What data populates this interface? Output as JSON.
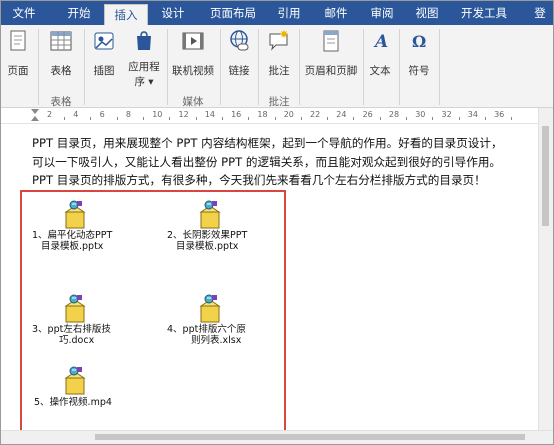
{
  "tabs": [
    "文件",
    "开始",
    "插入",
    "设计",
    "页面布局",
    "引用",
    "邮件",
    "审阅",
    "视图",
    "开发工具",
    "登"
  ],
  "ribbon": {
    "buttons": {
      "page": "页面",
      "table": "表格",
      "illustrations": "插图",
      "apps": "应用程",
      "apps2": "序 ▾",
      "online_video": "联机视频",
      "links": "链接",
      "comment": "批注",
      "header_footer": "页眉和页脚",
      "text": "文本",
      "symbols": "符号"
    },
    "groups": {
      "table": "表格",
      "media": "媒体",
      "comments": "批注"
    }
  },
  "ruler": {
    "numbers": [
      "2",
      "4",
      "6",
      "8",
      "10",
      "12",
      "14",
      "16",
      "18",
      "20",
      "22",
      "24",
      "26",
      "28",
      "30",
      "32",
      "34",
      "36"
    ]
  },
  "document": {
    "paragraph_lines": [
      "PPT 目录页，用来展现整个 PPT 内容结构框架，起到一个导航的作用。好看的目录页设计，",
      "可以一下吸引人，又能让人看出整份 PPT 的逻辑关系，而且能对观众起到很好的引导作用。",
      "PPT 目录页的排版方式，有很多种，今天我们先来看看几个左右分栏排版方式的目录页！"
    ],
    "objects": [
      {
        "line1": "1、扁平化动态PPT",
        "line2": "目录模板.pptx"
      },
      {
        "line1": "2、长阴影效果PPT",
        "line2": "目录模板.pptx"
      },
      {
        "line1": "3、ppt左右排版技",
        "line2": "巧.docx"
      },
      {
        "line1": "4、ppt排版六个原",
        "line2": "则列表.xlsx"
      },
      {
        "line1": "5、操作视频.mp4",
        "line2": ""
      }
    ]
  },
  "colors": {
    "tab_bar": "#2b579a",
    "highlight_box": "#d9453f"
  }
}
